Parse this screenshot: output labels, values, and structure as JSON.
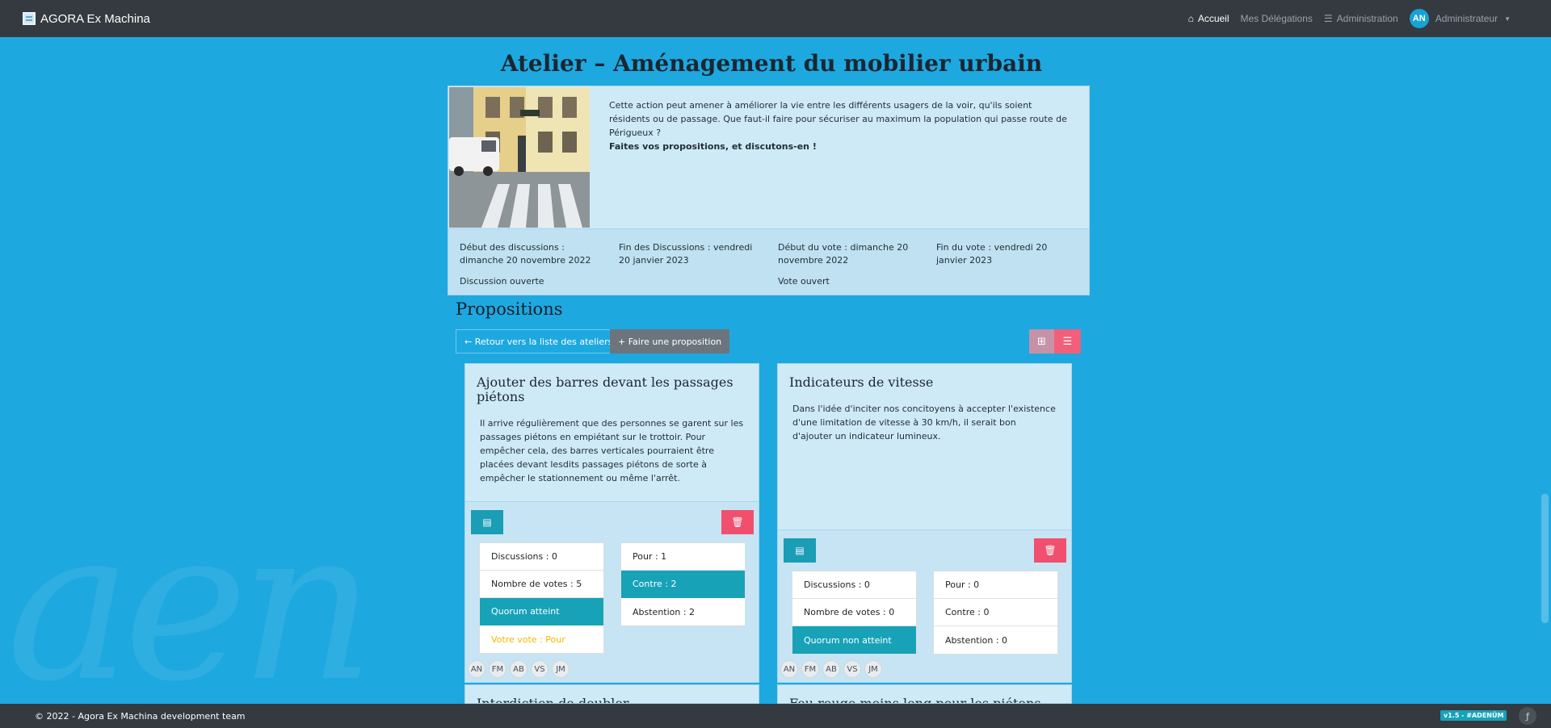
{
  "nav": {
    "brand": "AGORA Ex Machina",
    "links": [
      {
        "label": "Accueil",
        "icon": "home-icon"
      },
      {
        "label": "Mes Délégations",
        "icon": ""
      },
      {
        "label": "Administration",
        "icon": "sliders-icon"
      }
    ],
    "user": {
      "initials": "AN",
      "name": "Administrateur"
    }
  },
  "atelier": {
    "title": "Atelier – Aménagement du mobilier urbain",
    "description": "Cette action peut amener à améliorer la vie entre les différents usagers de la voir, qu'ils soient résidents ou de passage. Que faut-il faire pour sécuriser au maximum la population qui passe route de Périgueux ?",
    "description_bold": "Faites vos propositions, et discutons-en !",
    "dates": [
      "Début des discussions : dimanche 20 novembre 2022",
      "Fin des Discussions : vendredi 20 janvier 2023",
      "Début du vote : dimanche 20 novembre 2022",
      "Fin du vote : vendredi 20 janvier 2023"
    ],
    "discussion_status": "Discussion ouverte",
    "vote_status": "Vote ouvert"
  },
  "propositions": {
    "heading": "Propositions",
    "back_label": "← Retour vers la liste des ateliers",
    "new_label": "+  Faire une proposition",
    "cards": [
      {
        "title": "Ajouter des barres devant les passages piétons",
        "text": "Il arrive régulièrement que des personnes se garent sur les passages piétons en empiétant sur le trottoir. Pour empêcher cela, des barres verticales pourraient être placées devant lesdits passages piétons de sorte à empêcher le stationnement ou même l'arrêt.",
        "discussions": "Discussions : 0",
        "votes": "Nombre de votes : 5",
        "quorum": "Quorum atteint",
        "my_vote": "Votre vote : Pour",
        "pour": "Pour : 1",
        "contre": "Contre : 2",
        "abstention": "Abstention : 2",
        "voters": [
          "AN",
          "FM",
          "AB",
          "VS",
          "JM"
        ]
      },
      {
        "title": "Indicateurs de vitesse",
        "text": "Dans l'idée d'inciter nos concitoyens à accepter l'existence d'une limitation de vitesse à 30 km/h, il serait bon d'ajouter un indicateur lumineux.",
        "discussions": "Discussions : 0",
        "votes": "Nombre de votes : 0",
        "quorum": "Quorum non atteint",
        "pour": "Pour : 0",
        "contre": "Contre : 0",
        "abstention": "Abstention : 0",
        "voters": [
          "AN",
          "FM",
          "AB",
          "VS",
          "JM"
        ]
      },
      {
        "title": "Interdiction de doubler"
      },
      {
        "title": "Feu rouge moins long pour les piétons"
      }
    ]
  },
  "footer": {
    "copyright": "© 2022 - Agora Ex Machina development team",
    "version": "v1.5 - #ADENÜM"
  }
}
